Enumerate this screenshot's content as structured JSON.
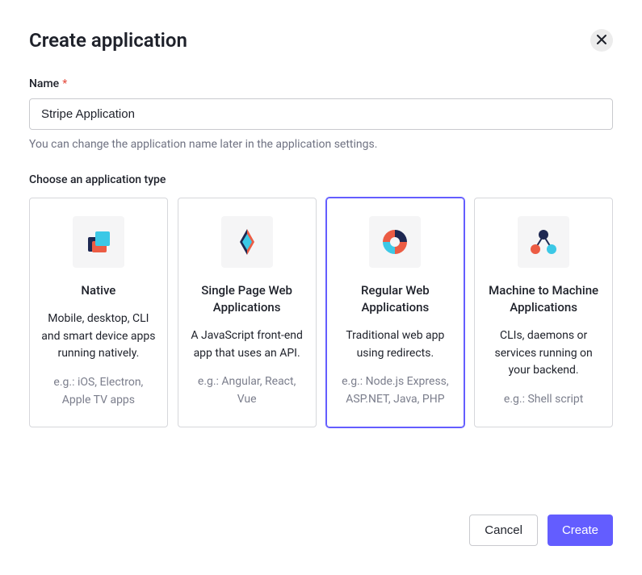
{
  "header": {
    "title": "Create application"
  },
  "form": {
    "name_label": "Name",
    "name_required": "*",
    "name_value": "Stripe Application",
    "name_hint": "You can change the application name later in the application settings."
  },
  "type_section": {
    "label": "Choose an application type",
    "selected_index": 2,
    "options": [
      {
        "title": "Native",
        "description": "Mobile, desktop, CLI and smart device apps running natively.",
        "example": "e.g.: iOS, Electron, Apple TV apps"
      },
      {
        "title": "Single Page Web Applications",
        "description": "A JavaScript front-end app that uses an API.",
        "example": "e.g.: Angular, React, Vue"
      },
      {
        "title": "Regular Web Applications",
        "description": "Traditional web app using redirects.",
        "example": "e.g.: Node.js Express, ASP.NET, Java, PHP"
      },
      {
        "title": "Machine to Machine Applications",
        "description": "CLIs, daemons or services running on your backend.",
        "example": "e.g.: Shell script"
      }
    ]
  },
  "footer": {
    "cancel": "Cancel",
    "create": "Create"
  }
}
